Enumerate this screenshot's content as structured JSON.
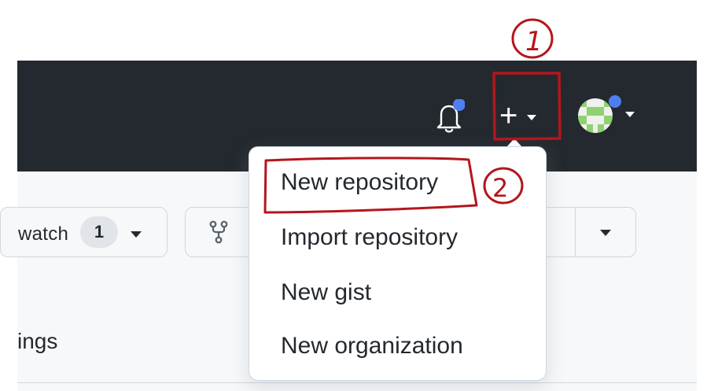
{
  "header": {
    "bell_icon": "bell-icon",
    "create_icon": "plus-icon",
    "create_label": "+",
    "avatar_icon": "identicon-avatar"
  },
  "repo_actions": {
    "watch_label": "watch",
    "watch_count": "1",
    "fork_icon": "repo-forked-icon"
  },
  "tabs": {
    "settings_partial": "ings"
  },
  "create_menu": {
    "items": [
      "New repository",
      "Import repository",
      "New gist",
      "New organization"
    ]
  },
  "annotations": {
    "step_1": "1",
    "step_2": "2",
    "color": "#b3161d"
  },
  "colors": {
    "header_bg": "#24292f",
    "notification_dot": "#4d7ff1",
    "avatar_green": "#8fd16f"
  }
}
